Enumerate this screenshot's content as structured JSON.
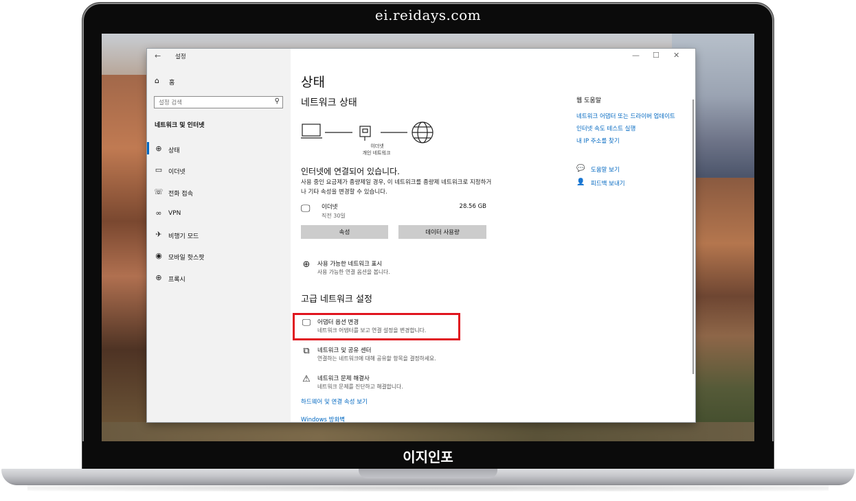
{
  "branding": {
    "site": "ei.reidays.com",
    "footer": "이지인포"
  },
  "window": {
    "app_title": "설정",
    "controls": {
      "minimize": "—",
      "maximize": "☐",
      "close": "✕"
    }
  },
  "sidebar": {
    "home_label": "홈",
    "search_placeholder": "설정 검색",
    "section_title": "네트워크 및 인터넷",
    "items": [
      {
        "label": "상태",
        "icon": "globe-network-icon",
        "active": true
      },
      {
        "label": "이더넷",
        "icon": "ethernet-icon",
        "active": false
      },
      {
        "label": "전화 접속",
        "icon": "dialup-icon",
        "active": false
      },
      {
        "label": "VPN",
        "icon": "vpn-icon",
        "active": false
      },
      {
        "label": "비행기 모드",
        "icon": "airplane-icon",
        "active": false
      },
      {
        "label": "모바일 핫스팟",
        "icon": "hotspot-icon",
        "active": false
      },
      {
        "label": "프록시",
        "icon": "proxy-globe-icon",
        "active": false
      }
    ]
  },
  "main": {
    "page_title": "상태",
    "network_status_heading": "네트워크 상태",
    "diagram": {
      "adapter": "이더넷",
      "network_type": "개인 네트워크"
    },
    "status_title": "인터넷에 연결되어 있습니다.",
    "status_desc": "사용 중인 요금제가 종량제일 경우, 이 네트워크를 종량제 네트워크로 지정하거나 기타 속성을 변경할 수 있습니다.",
    "connection": {
      "name": "이더넷",
      "sub": "직전 30일",
      "usage": "28.56 GB"
    },
    "buttons": {
      "properties": "속성",
      "data_usage": "데이터 사용량"
    },
    "show_networks": {
      "title": "사용 가능한 네트워크 표시",
      "desc": "사용 가능한 연결 옵션을 봅니다."
    },
    "advanced_heading": "고급 네트워크 설정",
    "advanced": [
      {
        "title": "어댑터 옵션 변경",
        "desc": "네트워크 어댑터를 보고 연결 설정을 변경합니다."
      },
      {
        "title": "네트워크 및 공유 센터",
        "desc": "연결하는 네트워크에 대해 공유할 항목을 결정하세요."
      },
      {
        "title": "네트워크 문제 해결사",
        "desc": "네트워크 문제를 진단하고 해결합니다."
      }
    ],
    "hardware_link": "하드웨어 및 연결 속성 보기",
    "firewall_link": "Windows 방화벽"
  },
  "help_panel": {
    "title": "웹 도움말",
    "links": [
      "네트워크 어댑터 또는 드라이버 업데이트",
      "인터넷 속도 테스트 실행",
      "내 IP 주소를 찾기"
    ],
    "actions": [
      {
        "label": "도움말 보기",
        "icon": "help-chat-icon"
      },
      {
        "label": "피드백 보내기",
        "icon": "feedback-person-icon"
      }
    ]
  },
  "colors": {
    "accent": "#0067c0",
    "highlight": "#e0141e",
    "sidebar_bg": "#f2f2f2",
    "button_bg": "#cccccc"
  }
}
